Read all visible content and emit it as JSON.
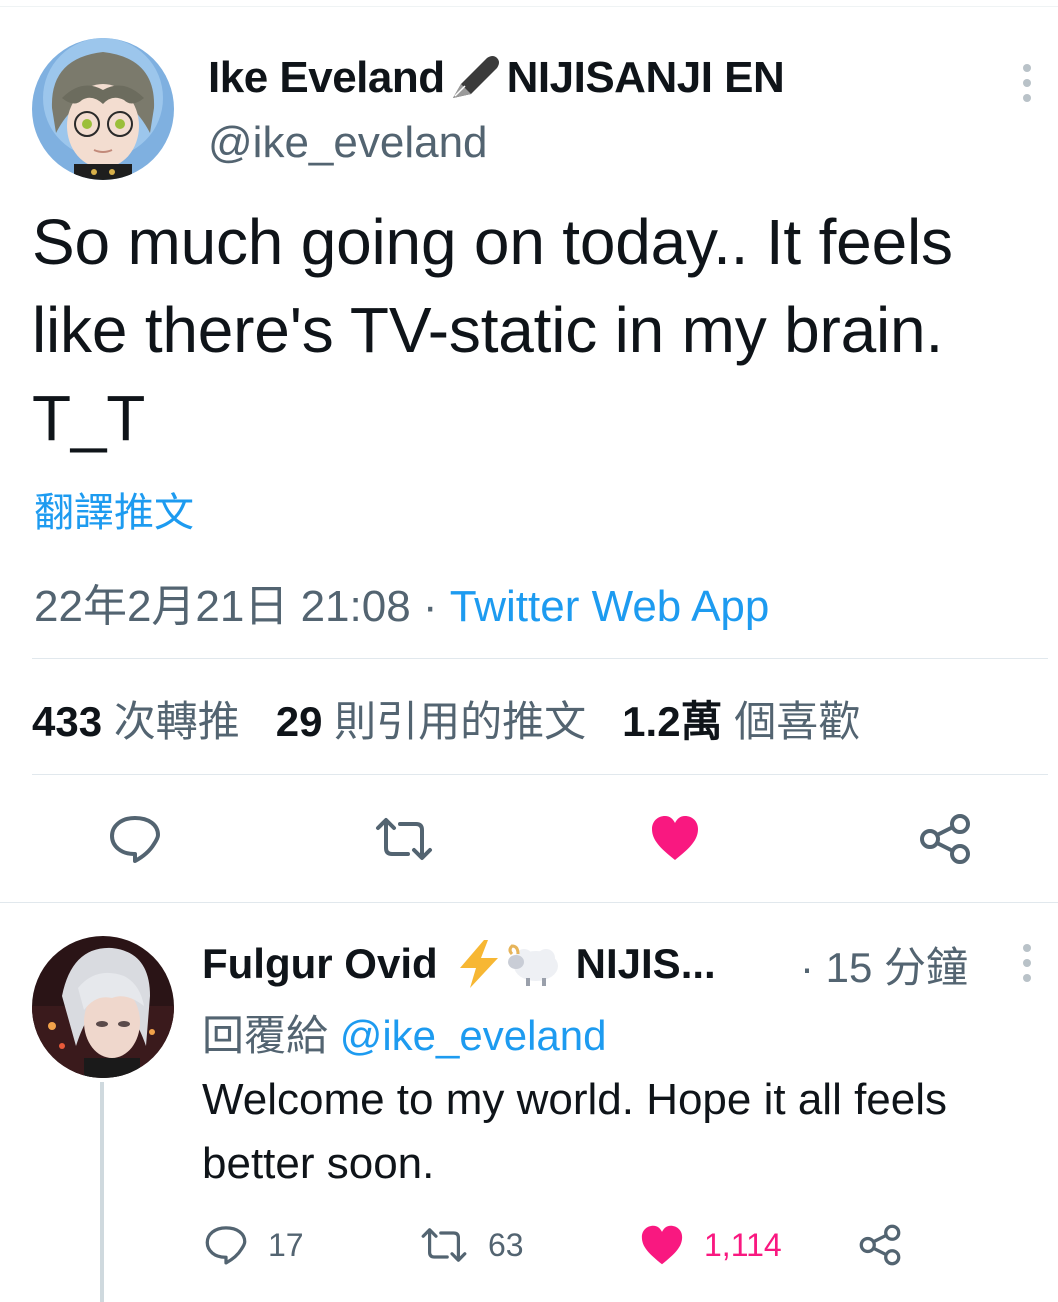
{
  "tweet": {
    "author_name": "Ike Eveland",
    "author_suffix": "NIJISANJI EN",
    "handle": "@ike_eveland",
    "text_line1": "So much going on today.. It feels",
    "text_line2": "like there's TV-static in my brain.",
    "text_line3": "T_T",
    "translate_label": "翻譯推文",
    "date": "22年2月21日 21:08",
    "separator": " · ",
    "source": "Twitter Web App",
    "retweets_count": "433",
    "retweets_label": "次轉推",
    "quotes_count": "29",
    "quotes_label": "則引用的推文",
    "likes_count": "1.2萬",
    "likes_label": "個喜歡"
  },
  "reply": {
    "author_name": "Fulgur Ovid",
    "author_suffix": "NIJIS...",
    "time": "· 15 分鐘",
    "reply_to_label": "回覆給",
    "reply_to_handle": "@ike_eveland",
    "text": "Welcome to my world. Hope it all feels better soon.",
    "reply_count": "17",
    "retweet_count": "63",
    "like_count": "1,114"
  },
  "colors": {
    "accent": "#1d9bf0",
    "like": "#f91880",
    "muted": "#536471"
  },
  "icons": {
    "pen": "fountain-pen-icon",
    "lightning": "lightning-icon",
    "sheep": "sheep-icon",
    "reply": "reply-icon",
    "retweet": "retweet-icon",
    "like": "heart-icon",
    "share": "share-icon",
    "more": "more-options-icon"
  }
}
